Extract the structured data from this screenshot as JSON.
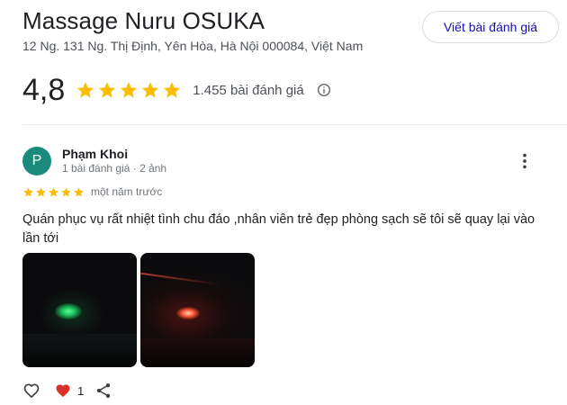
{
  "place": {
    "title": "Massage Nuru OSUKA",
    "address": "12 Ng. 131 Ng. Thị Định, Yên Hòa, Hà Nội 000084, Việt Nam",
    "write_review_label": "Viết bài đánh giá",
    "rating": "4,8",
    "star_count": 5,
    "review_count": "1.455 bài đánh giá"
  },
  "colors": {
    "star": "#fbbc04",
    "avatar": "#1a8a7d",
    "link": "#1a0dab",
    "liked_heart": "#d93025"
  },
  "icons": [
    "star-icon",
    "info-icon",
    "more-vert-icon",
    "heart-outline-icon",
    "heart-filled-icon",
    "share-icon"
  ],
  "review": {
    "avatar_letter": "P",
    "author": "Phạm Khoi",
    "meta": "1 bài đánh giá · 2 ảnh",
    "stars": 5,
    "time": "một năm trước",
    "text": "Quán phục vụ rất nhiệt tình chu đáo ,nhân viên trẻ đẹp phòng sạch sẽ tôi sẽ quay lại vào lần tới",
    "likes": "1"
  }
}
